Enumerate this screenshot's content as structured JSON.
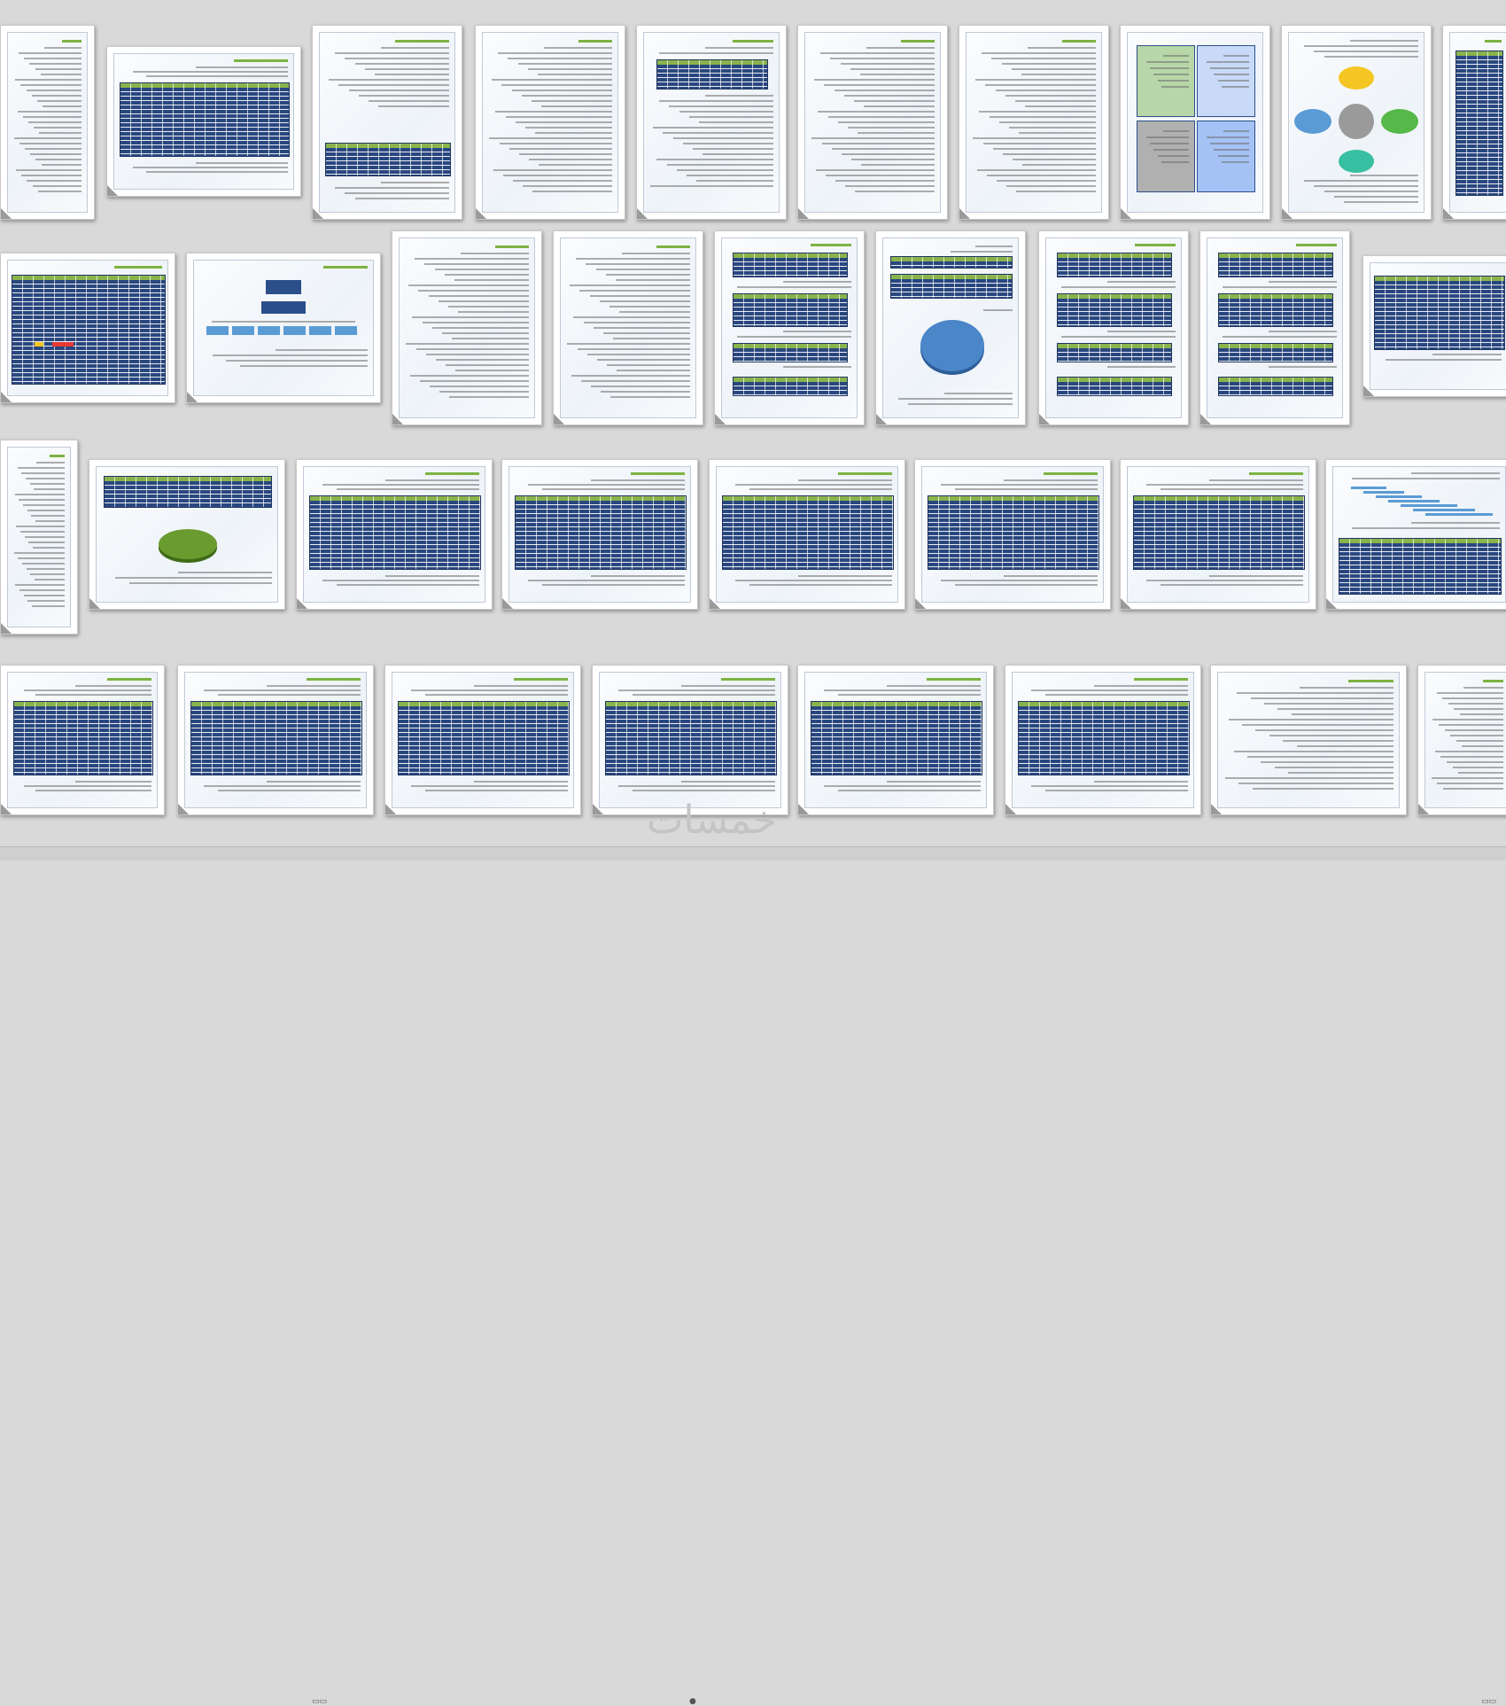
{
  "watermark": "خمسات",
  "view": "multi-page-thumbnail-view",
  "colors": {
    "background": "#d9d9d9",
    "page": "#ffffff",
    "table_blue": "#29477f",
    "table_header_green": "#8ab34c",
    "heading_green": "#7cb342",
    "pie_blue": "#4a86c8",
    "pie_green": "#6a9b2e",
    "cycle_yellow": "#f3c623",
    "cycle_green": "#55b848",
    "cycle_teal": "#36bfa0",
    "cycle_blue": "#5b9bd5",
    "cycle_gray": "#9a9a9a"
  },
  "pages": [
    {
      "kind": "text"
    },
    {
      "kind": "table"
    },
    {
      "kind": "text-table"
    },
    {
      "kind": "text"
    },
    {
      "kind": "table-text"
    },
    {
      "kind": "text"
    },
    {
      "kind": "text"
    },
    {
      "kind": "quad"
    },
    {
      "kind": "cycle"
    },
    {
      "kind": "table"
    },
    {
      "kind": "schedule"
    },
    {
      "kind": "org"
    },
    {
      "kind": "text"
    },
    {
      "kind": "text"
    },
    {
      "kind": "tables"
    },
    {
      "kind": "pie-blue"
    },
    {
      "kind": "tables"
    },
    {
      "kind": "tables"
    },
    {
      "kind": "wide-table"
    },
    {
      "kind": "text"
    },
    {
      "kind": "pie-green"
    },
    {
      "kind": "table"
    },
    {
      "kind": "table"
    },
    {
      "kind": "table"
    },
    {
      "kind": "table"
    },
    {
      "kind": "table"
    },
    {
      "kind": "gantt"
    },
    {
      "kind": "table"
    },
    {
      "kind": "table"
    },
    {
      "kind": "table"
    },
    {
      "kind": "table"
    },
    {
      "kind": "table"
    },
    {
      "kind": "table"
    },
    {
      "kind": "text"
    },
    {
      "kind": "text"
    }
  ]
}
